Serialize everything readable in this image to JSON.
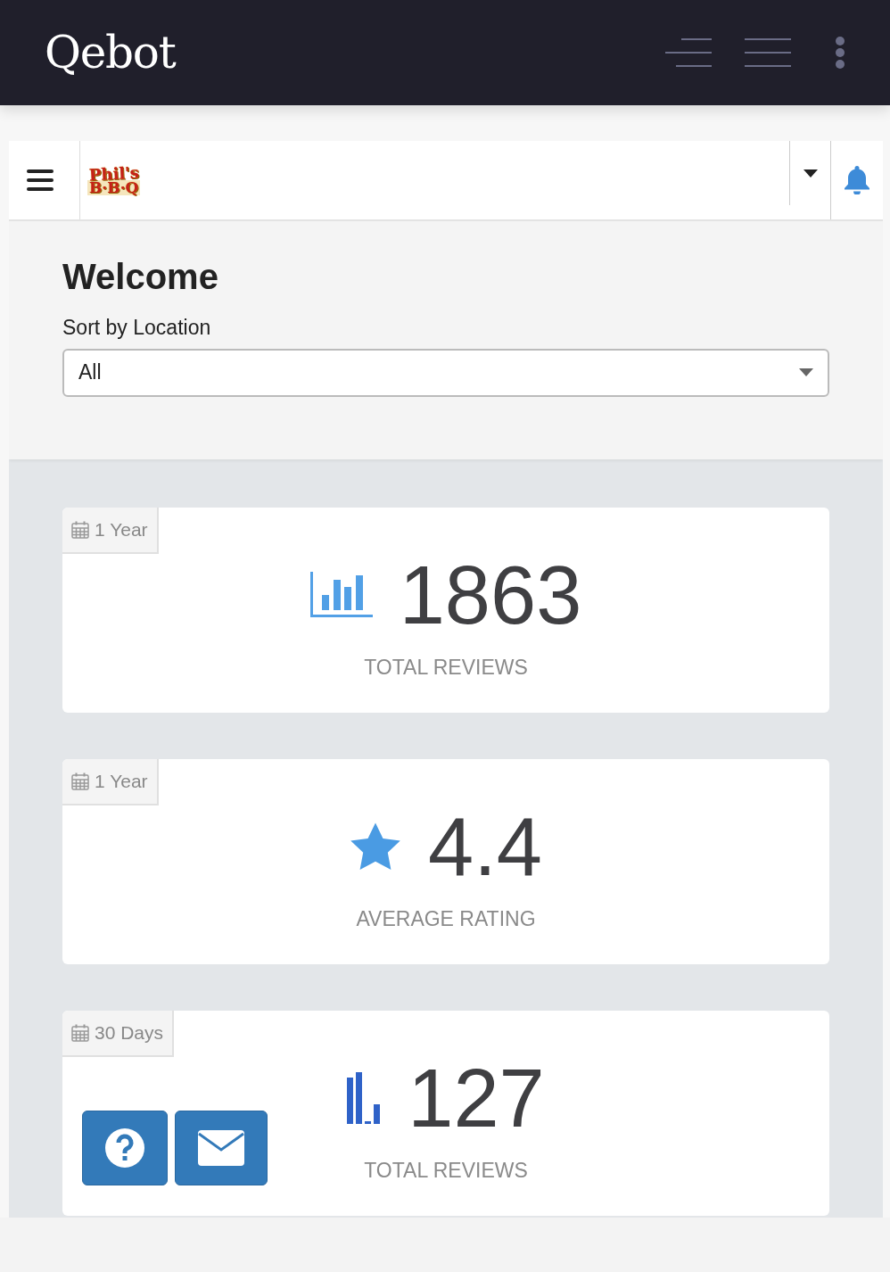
{
  "app_bar": {
    "title": "Qebot"
  },
  "header": {
    "logo": {
      "line_1": "Phil's",
      "line_2": "B·B·Q"
    }
  },
  "welcome": {
    "title": "Welcome",
    "sort_label": "Sort by Location",
    "location_select": {
      "value": "All"
    }
  },
  "stats": [
    {
      "period": "1 Year",
      "kind": "bar-chart",
      "value": "1863",
      "label": "TOTAL REVIEWS"
    },
    {
      "period": "1 Year",
      "kind": "star",
      "value": "4.4",
      "label": "AVERAGE RATING"
    },
    {
      "period": "30 Days",
      "kind": "mini-bars",
      "value": "127",
      "label": "TOTAL REVIEWS"
    }
  ],
  "floating_buttons": [
    {
      "kind": "help"
    },
    {
      "kind": "mail"
    }
  ]
}
